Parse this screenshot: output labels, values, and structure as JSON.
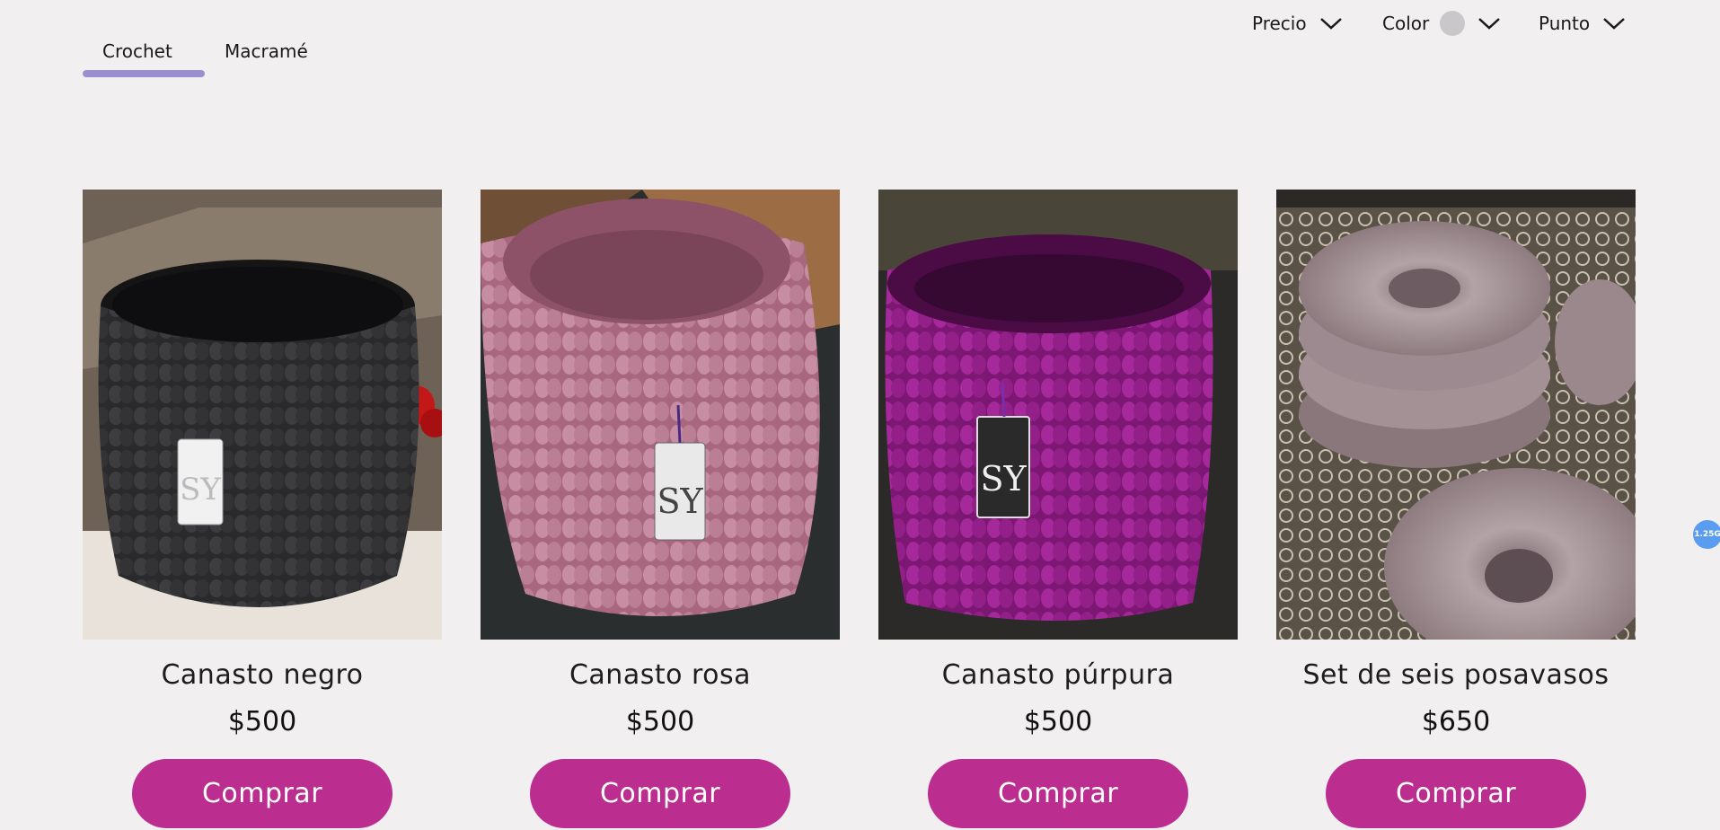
{
  "tabs": [
    {
      "label": "Crochet",
      "active": true
    },
    {
      "label": "Macramé",
      "active": false
    }
  ],
  "filters": {
    "price_label": "Precio",
    "color_label": "Color",
    "stitch_label": "Punto",
    "color_selected": "#c9c7c9"
  },
  "products": [
    {
      "name": "Canasto negro",
      "price": "$500",
      "button": "Comprar",
      "color": "#2a2a2c"
    },
    {
      "name": "Canasto rosa",
      "price": "$500",
      "button": "Comprar",
      "color": "#b9788f"
    },
    {
      "name": "Canasto púrpura",
      "price": "$500",
      "button": "Comprar",
      "color": "#8e1d86"
    },
    {
      "name": "Set de seis posavasos",
      "price": "$650",
      "button": "Comprar",
      "color": "#a8959a"
    }
  ],
  "badge": {
    "text": "1.25G"
  },
  "colors": {
    "accent": "#bb2d8f",
    "tab_underline": "#9b8fce",
    "background": "#f2eff1"
  }
}
